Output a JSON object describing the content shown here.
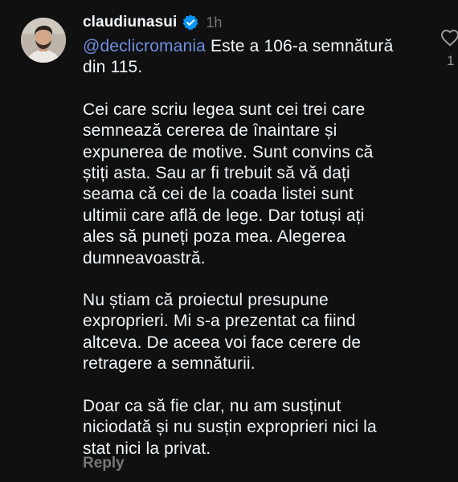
{
  "comment": {
    "author": {
      "username": "claudiunasui",
      "verified": true,
      "avatar": "avatar-photo"
    },
    "time": "1h",
    "mention": "@declicromania",
    "first_line_rest": " Este a 106-a semnătură",
    "first_line_cont": "din 115.",
    "paragraph_2": [
      "Cei care scriu legea sunt cei trei care",
      "semnează cererea de înaintare și",
      "expunerea de motive. Sunt convins că",
      "știți asta. Sau ar fi trebuit să vă dați",
      "seama că cei de la coada listei sunt",
      "ultimii care află de lege. Dar totuși ați",
      "ales să puneți poza mea. Alegerea",
      "dumneavoastră."
    ],
    "paragraph_3": [
      "Nu știam că proiectul presupune",
      "exproprieri. Mi s-a prezentat ca fiind",
      "altceva. De aceea voi face cerere de",
      "retragere a semnăturii."
    ],
    "paragraph_4": [
      "Doar ca să fie clar, nu am susținut",
      "niciodată și nu susțin exproprieri nici la",
      "stat nici la privat."
    ],
    "reply_label": "Reply",
    "like_icon": "heart-outline-icon",
    "like_count": "1"
  },
  "colors": {
    "background": "#101010",
    "text": "#f3f5f7",
    "muted": "#777777",
    "mention": "#6e8fe0",
    "verified_badge": "#0095f6"
  }
}
